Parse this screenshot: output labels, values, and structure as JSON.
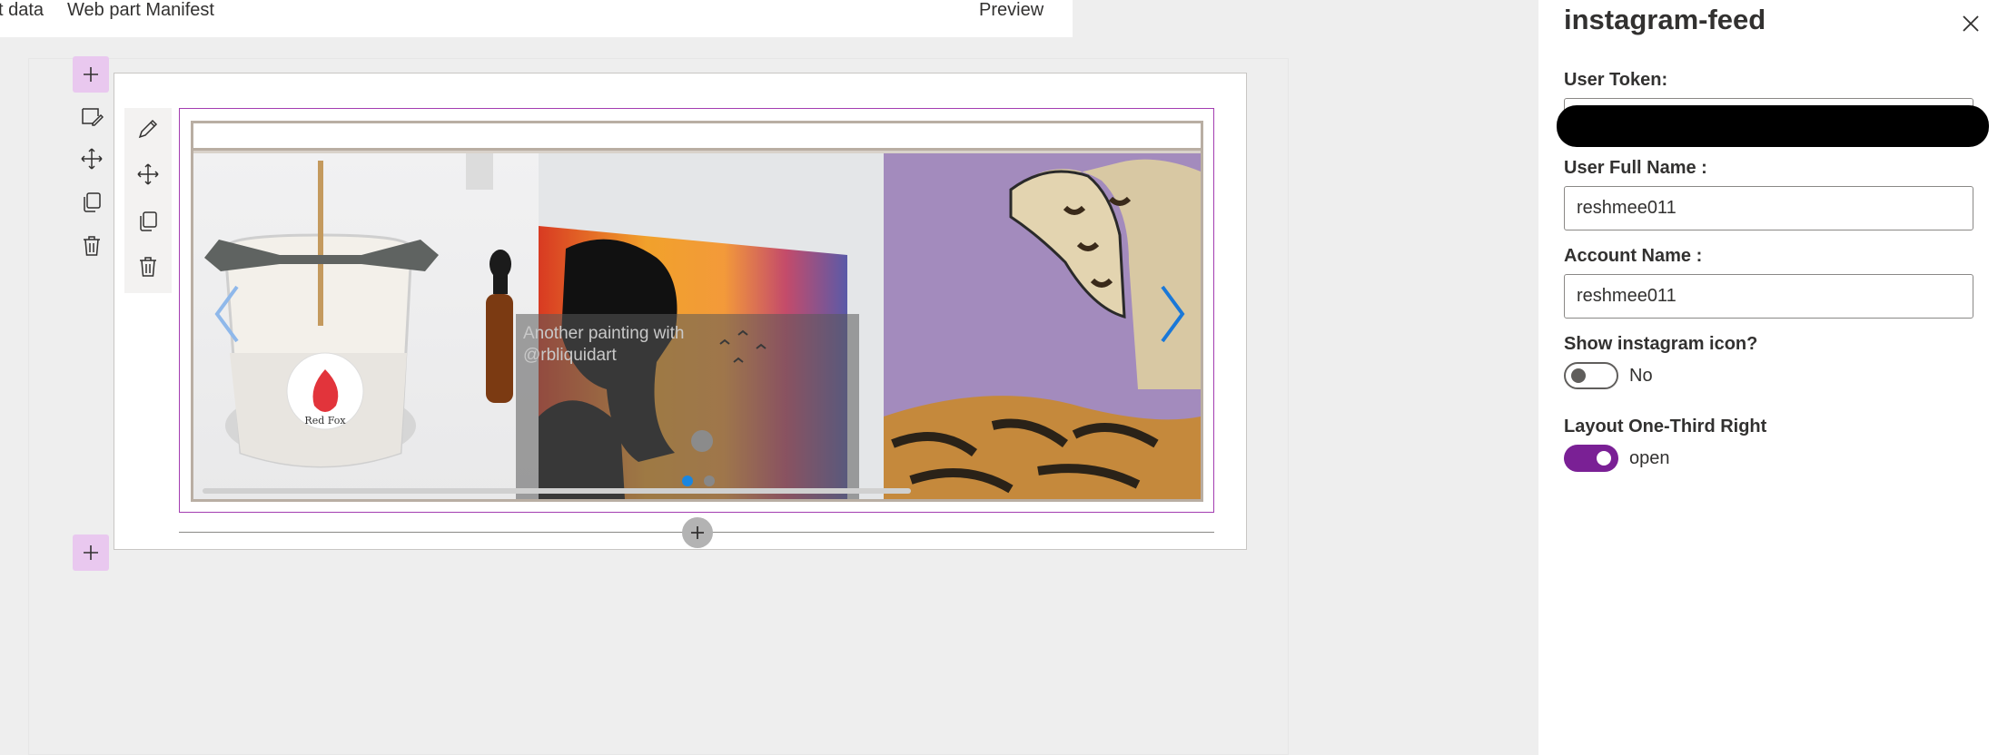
{
  "topbar": {
    "tab_partial": "t data",
    "tab_manifest": "Web part Manifest",
    "preview": "Preview"
  },
  "webpart": {
    "caption": "Another painting with @rbliquidart",
    "slide_count": 2,
    "active_slide": 1
  },
  "pane": {
    "title": "instagram-feed",
    "user_token_label": "User Token:",
    "user_full_name_label": "User Full Name :",
    "user_full_name_value": "reshmee011",
    "account_name_label": "Account Name :",
    "account_name_value": "reshmee011",
    "show_icon_label": "Show instagram icon?",
    "show_icon_state": "No",
    "layout_label": "Layout One-Third Right",
    "layout_state": "open"
  },
  "colors": {
    "accent": "#7a2095",
    "add_button_bg": "#e9c8ef",
    "webpart_border": "#a33db1",
    "dot_active": "#1a86e0"
  }
}
